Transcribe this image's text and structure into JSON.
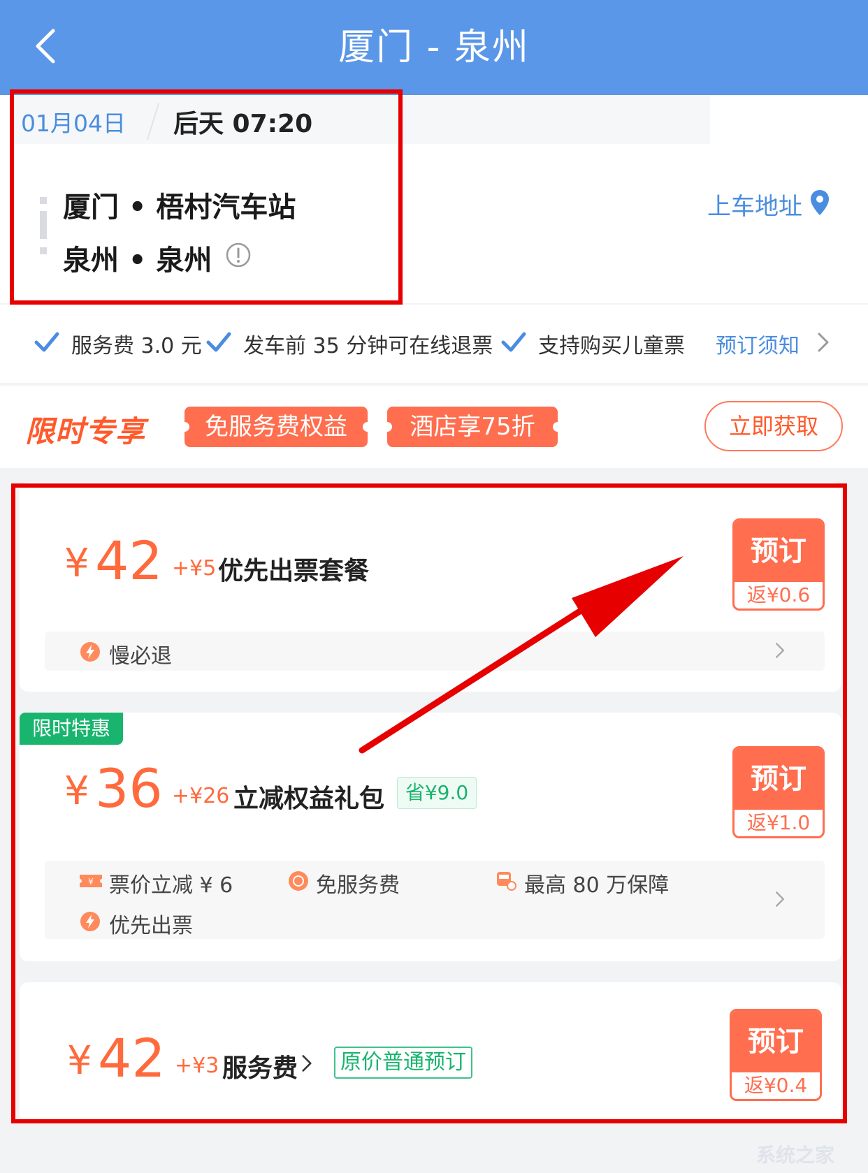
{
  "header": {
    "title": "厦门 - 泉州"
  },
  "trip": {
    "date": "01月04日",
    "depart": "后天 07:20",
    "from": "厦门 • 梧村汽车站",
    "to": "泉州 • 泉州",
    "boarding_label": "上车地址"
  },
  "services": {
    "items": [
      "服务费 3.0 元",
      "发车前 35 分钟可在线退票",
      "支持购买儿童票"
    ],
    "notice_label": "预订须知"
  },
  "promo": {
    "title": "限时专享",
    "tags": [
      "免服务费权益",
      "酒店享75折"
    ],
    "get_label": "立即获取"
  },
  "tickets": [
    {
      "currency": "¥",
      "price": "42",
      "addon_price": "+¥5",
      "addon_name": "优先出票套餐",
      "book_label": "预订",
      "cashback": "返¥0.6",
      "benefits": [
        "慢必退"
      ]
    },
    {
      "badge": "限时特惠",
      "currency": "¥",
      "price": "36",
      "addon_price": "+¥26",
      "addon_name": "立减权益礼包",
      "save": "省¥9.0",
      "book_label": "预订",
      "cashback": "返¥1.0",
      "benefits": [
        "票价立减 ¥ 6",
        "免服务费",
        "最高 80 万保障",
        "优先出票"
      ]
    },
    {
      "currency": "¥",
      "price": "42",
      "addon_price": "+¥3",
      "addon_name": "服务费",
      "tag": "原价普通预订",
      "book_label": "预订",
      "cashback": "返¥0.4"
    }
  ],
  "colors": {
    "header": "#5b97e8",
    "accent": "#ff6e4f",
    "link": "#4a8de0",
    "green": "#19b46e",
    "annotation": "#e60000"
  },
  "watermark": "系统之家"
}
